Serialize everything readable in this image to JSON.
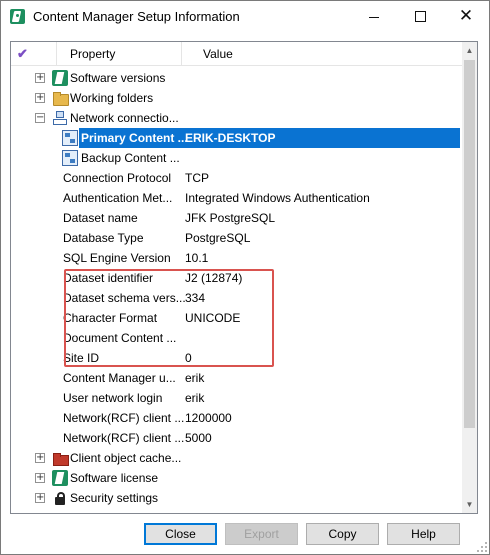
{
  "window": {
    "title": "Content Manager Setup Information",
    "icon": "content-manager-icon"
  },
  "list": {
    "header": {
      "check": "✔",
      "property": "Property",
      "value": "Value"
    },
    "rows": [
      {
        "label": "Software versions",
        "value": "",
        "expander": "+",
        "icon": "software-icon"
      },
      {
        "label": "Working folders",
        "value": "",
        "expander": "+",
        "icon": "folder-icon"
      },
      {
        "label": "Network connectio...",
        "value": "",
        "expander": "−",
        "icon": "network-icon"
      },
      {
        "label": "Primary Content ...",
        "value": "ERIK-DESKTOP",
        "icon": "server-icon",
        "selected": true
      },
      {
        "label": "Backup Content ...",
        "value": "",
        "icon": "server-icon"
      },
      {
        "label": "Connection Protocol",
        "value": "TCP"
      },
      {
        "label": "Authentication Met...",
        "value": "Integrated Windows Authentication"
      },
      {
        "label": "Dataset name",
        "value": "JFK PostgreSQL"
      },
      {
        "label": "Database Type",
        "value": "PostgreSQL"
      },
      {
        "label": "SQL Engine Version",
        "value": "10.1"
      },
      {
        "label": "Dataset identifier",
        "value": "J2 (12874)"
      },
      {
        "label": "Dataset schema vers...",
        "value": "334"
      },
      {
        "label": "Character Format",
        "value": "UNICODE"
      },
      {
        "label": "Document Content ...",
        "value": ""
      },
      {
        "label": "Site ID",
        "value": "0"
      },
      {
        "label": "Content Manager u...",
        "value": "erik"
      },
      {
        "label": "User network login",
        "value": "erik"
      },
      {
        "label": "Network(RCF) client ...",
        "value": "1200000"
      },
      {
        "label": "Network(RCF) client ...",
        "value": "5000"
      },
      {
        "label": "Client object cache...",
        "value": "",
        "expander": "+",
        "icon": "cache-icon"
      },
      {
        "label": "Software license",
        "value": "",
        "expander": "+",
        "icon": "license-icon"
      },
      {
        "label": "Security settings",
        "value": "",
        "expander": "+",
        "icon": "lock-icon"
      }
    ]
  },
  "buttons": {
    "close": "Close",
    "export": "Export",
    "copy": "Copy",
    "help": "Help"
  },
  "colors": {
    "selection": "#0a73d2",
    "highlight_box": "#d9534f",
    "default_button_border": "#0078d7"
  }
}
